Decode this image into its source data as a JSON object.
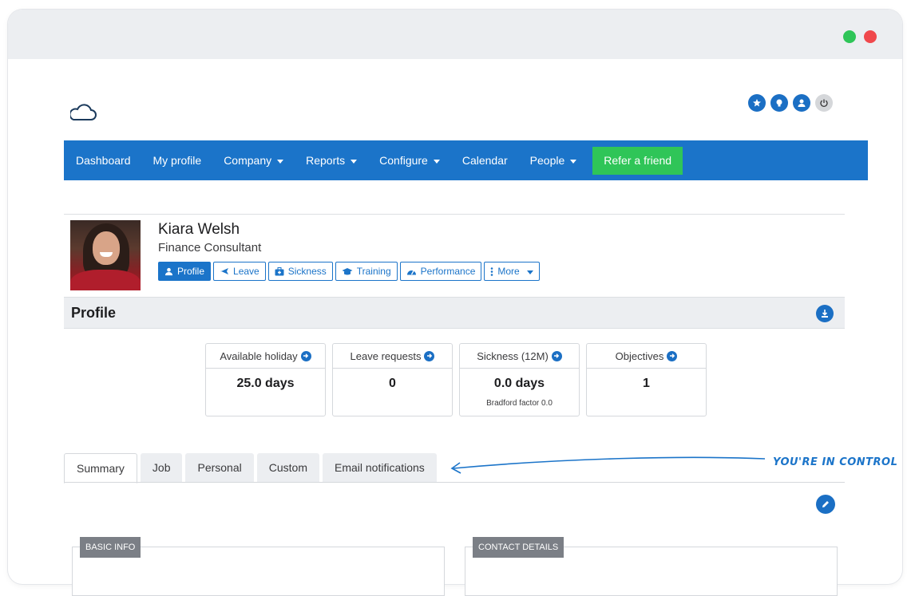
{
  "navbar": {
    "items": [
      {
        "label": "Dashboard",
        "dropdown": false
      },
      {
        "label": "My profile",
        "dropdown": false
      },
      {
        "label": "Company",
        "dropdown": true
      },
      {
        "label": "Reports",
        "dropdown": true
      },
      {
        "label": "Configure",
        "dropdown": true
      },
      {
        "label": "Calendar",
        "dropdown": false
      },
      {
        "label": "People",
        "dropdown": true
      }
    ],
    "cta_label": "Refer a friend"
  },
  "top_icons": [
    "star-icon",
    "lightbulb-icon",
    "user-icon",
    "power-icon"
  ],
  "profile": {
    "name": "Kiara Welsh",
    "job_title": "Finance Consultant",
    "tabs": [
      {
        "label": "Profile",
        "icon": "user-icon",
        "active": true
      },
      {
        "label": "Leave",
        "icon": "plane-icon",
        "active": false
      },
      {
        "label": "Sickness",
        "icon": "medkit-icon",
        "active": false
      },
      {
        "label": "Training",
        "icon": "graduation-cap-icon",
        "active": false
      },
      {
        "label": "Performance",
        "icon": "gauge-icon",
        "active": false
      },
      {
        "label": "More",
        "icon": "vertical-dots-icon",
        "active": false
      }
    ]
  },
  "section": {
    "title": "Profile"
  },
  "stats": [
    {
      "label": "Available holiday",
      "value": "25.0 days",
      "sub": ""
    },
    {
      "label": "Leave requests",
      "value": "0",
      "sub": ""
    },
    {
      "label": "Sickness (12M)",
      "value": "0.0 days",
      "sub": "Bradford factor 0.0"
    },
    {
      "label": "Objectives",
      "value": "1",
      "sub": ""
    }
  ],
  "tabs": [
    {
      "label": "Summary",
      "active": true
    },
    {
      "label": "Job",
      "active": false
    },
    {
      "label": "Personal",
      "active": false
    },
    {
      "label": "Custom",
      "active": false
    },
    {
      "label": "Email notifications",
      "active": false
    }
  ],
  "panels": {
    "left": "BASIC INFO",
    "right": "CONTACT DETAILS"
  },
  "callout": "YOU'RE IN CONTROL",
  "colors": {
    "primary": "#1b74c9",
    "success": "#2fc558",
    "danger": "#f0484c"
  }
}
